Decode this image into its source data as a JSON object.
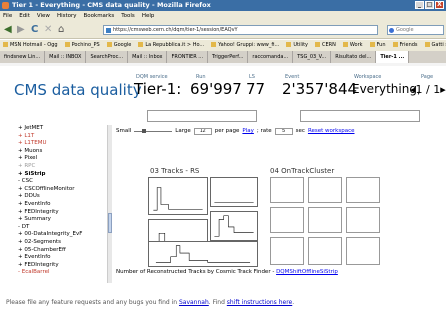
{
  "window": {
    "title": "Tier 1 - Everything - CMS data quality - Mozilla Firefox",
    "buttons": [
      "_",
      "□",
      "X"
    ]
  },
  "menu": [
    "File",
    "Edit",
    "View",
    "History",
    "Bookmarks",
    "Tools",
    "Help"
  ],
  "nav": {
    "url": "https://cmsweb.cern.ch/dqm/tier-1/session/EAQvY",
    "search_placeholder": "Google",
    "back": "◀",
    "forward": "▶",
    "reload": "C",
    "stop": "✕",
    "home": "⌂"
  },
  "bookmarks": [
    "MSN Hotmail - Ogg",
    "Pochino_PS",
    "Google",
    "La Repubblica.it > Ho...",
    "Yahoo! Gruppi: www_fi...",
    "Utility",
    "CERN",
    "Work",
    "Fun",
    "Friends",
    "Gatti si naice - Forum"
  ],
  "tabs": [
    "findsnew Lin...",
    "Mail :: INBOX",
    "SearchProc...",
    "Mail :: Inbox",
    "FRONTIER ...",
    "TriggerPerf...",
    "raccomanda...",
    "TSG_03_V...",
    "Risultato del...",
    "Tier-1 ..."
  ],
  "header": {
    "app": "CMS data quality",
    "dqm_label": "DQM service",
    "dqm_value": "Tier-1:",
    "run_label": "Run",
    "run_value": "69'997",
    "ls_label": "LS",
    "ls_value": "77",
    "event_label": "Event",
    "event_value": "2'357'844",
    "workspace_label": "Workspace",
    "workspace_value": "Everything,",
    "page_label": "Page",
    "page_value": "◂1 / 1▸"
  },
  "sidebar": [
    {
      "text": "+ JetMET",
      "cls": ""
    },
    {
      "text": "+ L1T",
      "cls": "red"
    },
    {
      "text": "+ L1TEMU",
      "cls": "red"
    },
    {
      "text": "+ Muons",
      "cls": ""
    },
    {
      "text": "+ Pixel",
      "cls": ""
    },
    {
      "text": "+ RPC",
      "cls": "grey"
    },
    {
      "text": "+ SiStrip",
      "cls": "b"
    },
    {
      "text": "- CSC",
      "cls": ""
    },
    {
      "text": "+ CSCOfflineMonitor",
      "cls": ""
    },
    {
      "text": "+ DDUs",
      "cls": ""
    },
    {
      "text": "+ EventInfo",
      "cls": ""
    },
    {
      "text": "+ FEDIntegrity",
      "cls": ""
    },
    {
      "text": "+ Summary",
      "cls": ""
    },
    {
      "text": "- DT",
      "cls": ""
    },
    {
      "text": "+ 00-DataIntegrity_EvF",
      "cls": ""
    },
    {
      "text": "+ 02-Segments",
      "cls": ""
    },
    {
      "text": "+ 05-ChamberEff",
      "cls": ""
    },
    {
      "text": "+ EventInfo",
      "cls": ""
    },
    {
      "text": "+ FEDIntegrity",
      "cls": ""
    },
    {
      "text": "- EcalBarrel",
      "cls": "red"
    }
  ],
  "controls": {
    "small": "Small",
    "large": "Large",
    "per_page_value": "12",
    "per_page": "per page",
    "play": "Play",
    "rate": "; rate",
    "rate_value": "5",
    "sec": "sec",
    "reset": "Reset workspace"
  },
  "plots": {
    "left_title": "03 Tracks - RS",
    "right_title": "04 OnTrackCluster"
  },
  "caption": {
    "text": "Number of Reconstructed Tracks by Cosmic Track Finder - ",
    "link": "DQMShiftOfflineSiStrip"
  },
  "footer": {
    "pre": "Please file any feature requests and any bugs you find in ",
    "savannah": "Savannah",
    "mid": ". Find ",
    "shift": "shift instructions here",
    "post": "."
  }
}
